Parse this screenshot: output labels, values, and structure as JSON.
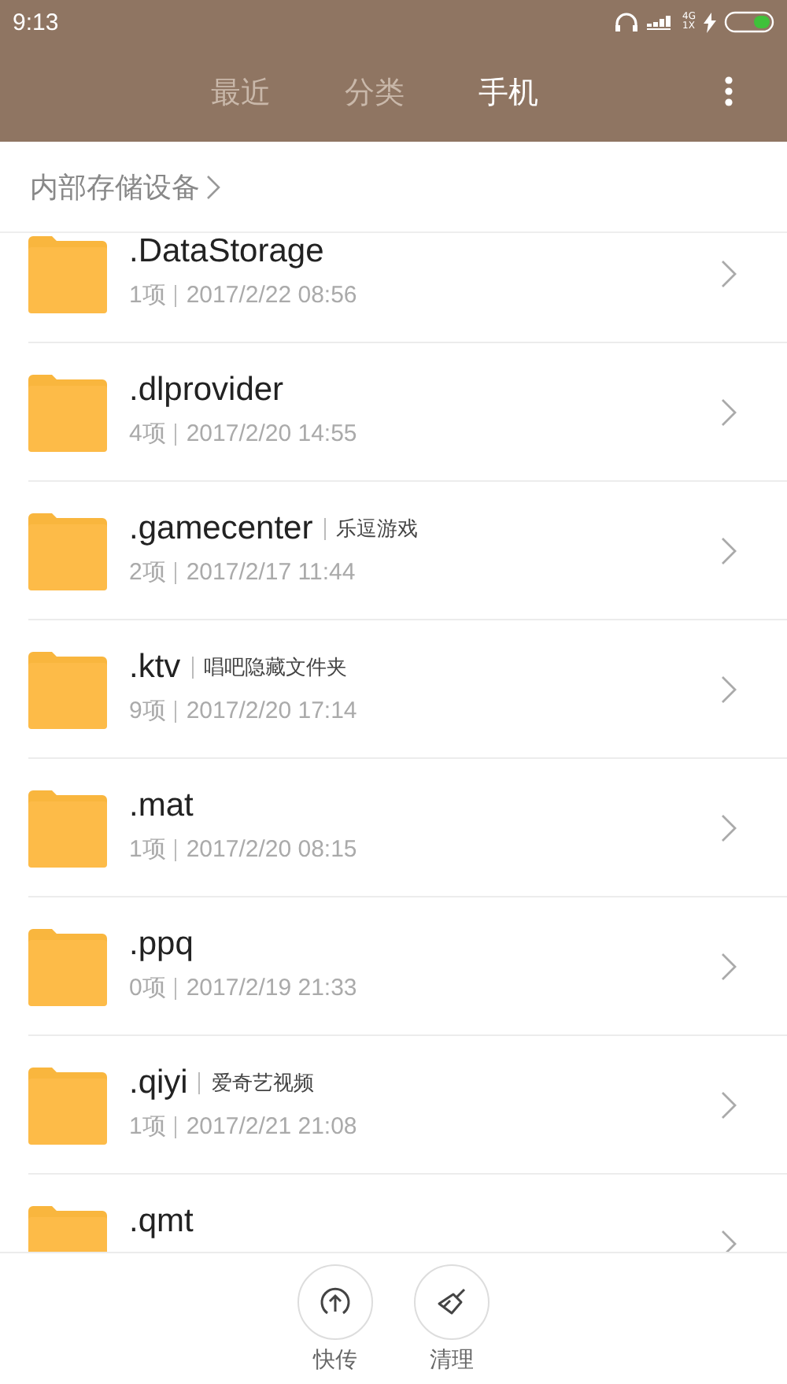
{
  "status_bar": {
    "time": "9:13",
    "network_top": "4G",
    "network_bottom": "1X"
  },
  "tabs": [
    {
      "label": "最近",
      "selected": false
    },
    {
      "label": "分类",
      "selected": false
    },
    {
      "label": "手机",
      "selected": true
    }
  ],
  "breadcrumb": "内部存储设备",
  "files": [
    {
      "name": ".DataStorage",
      "count": "1项",
      "date": "2017/2/22 08:56"
    },
    {
      "name": ".dlprovider",
      "count": "4项",
      "date": "2017/2/20 14:55"
    },
    {
      "name": ".gamecenter",
      "tag": "乐逗游戏",
      "count": "2项",
      "date": "2017/2/17 11:44"
    },
    {
      "name": ".ktv",
      "tag": "唱吧隐藏文件夹",
      "count": "9项",
      "date": "2017/2/20 17:14"
    },
    {
      "name": ".mat",
      "count": "1项",
      "date": "2017/2/20 08:15"
    },
    {
      "name": ".ppq",
      "count": "0项",
      "date": "2017/2/19 21:33"
    },
    {
      "name": ".qiyi",
      "tag": "爱奇艺视频",
      "count": "1项",
      "date": "2017/2/21 21:08"
    },
    {
      "name": ".qmt"
    }
  ],
  "actions": [
    {
      "kind": "transfer",
      "label": "快传"
    },
    {
      "kind": "clean",
      "label": "清理"
    }
  ]
}
